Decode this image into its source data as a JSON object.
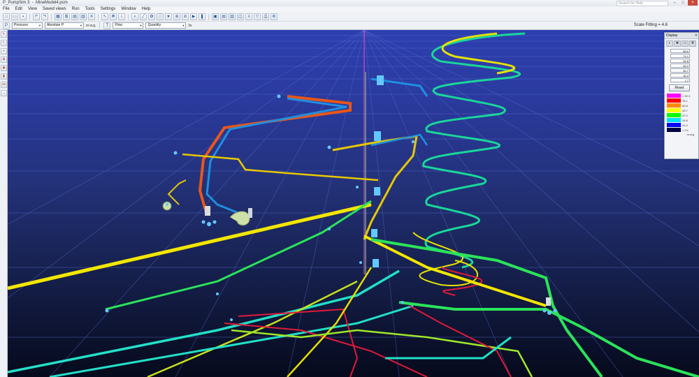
{
  "window": {
    "app_title": "P_PumpSim 3",
    "file_title": "MineModel4.psm",
    "search_placeholder": "Search for Help",
    "controls": [
      "–",
      "□"
    ],
    "close": "×"
  },
  "menu": [
    "File",
    "Edit",
    "View",
    "Saved views",
    "Run",
    "Tools",
    "Settings",
    "Window",
    "Help"
  ],
  "toolbar2": {
    "mode_select": "Pressure",
    "type_select": "Absolute P",
    "units": "m w.g.",
    "flow_select": "Flow",
    "quantity_select": "Quantity",
    "flow_units": "l/s",
    "scale_fitting": "Scale Fitting = 4.6"
  },
  "display_panel": {
    "title": "Display",
    "close": "✕",
    "fields": [
      "88.6",
      "74.1",
      "59.6",
      "45.2",
      "30.7",
      "16.2",
      "1.7"
    ],
    "reset_label": "Reset",
    "legend": [
      {
        "color": "#ff00ff",
        "value": "> 92.3"
      },
      {
        "color": "#ff0000",
        "value": "76.1"
      },
      {
        "color": "#ff8a00",
        "value": "60.8"
      },
      {
        "color": "#ffff00",
        "value": "49.7"
      },
      {
        "color": "#00ff00",
        "value": "37.2"
      },
      {
        "color": "#00e0ff",
        "value": "24.8"
      },
      {
        "color": "#0000ff",
        "value": "12.4"
      },
      {
        "color": "#000040",
        "value": "< 0.1"
      }
    ],
    "legend_unit": "m.w.g"
  },
  "colors": {
    "viewport_top": "#2d3fb0",
    "viewport_bottom": "#060a1c",
    "pipe_yellow": "#f2e600",
    "pipe_green": "#2be35a",
    "pipe_cyan": "#22e0c8",
    "pipe_orange": "#e8561a",
    "pipe_blue": "#1f8fe0",
    "pipe_red": "#e01a3a"
  }
}
